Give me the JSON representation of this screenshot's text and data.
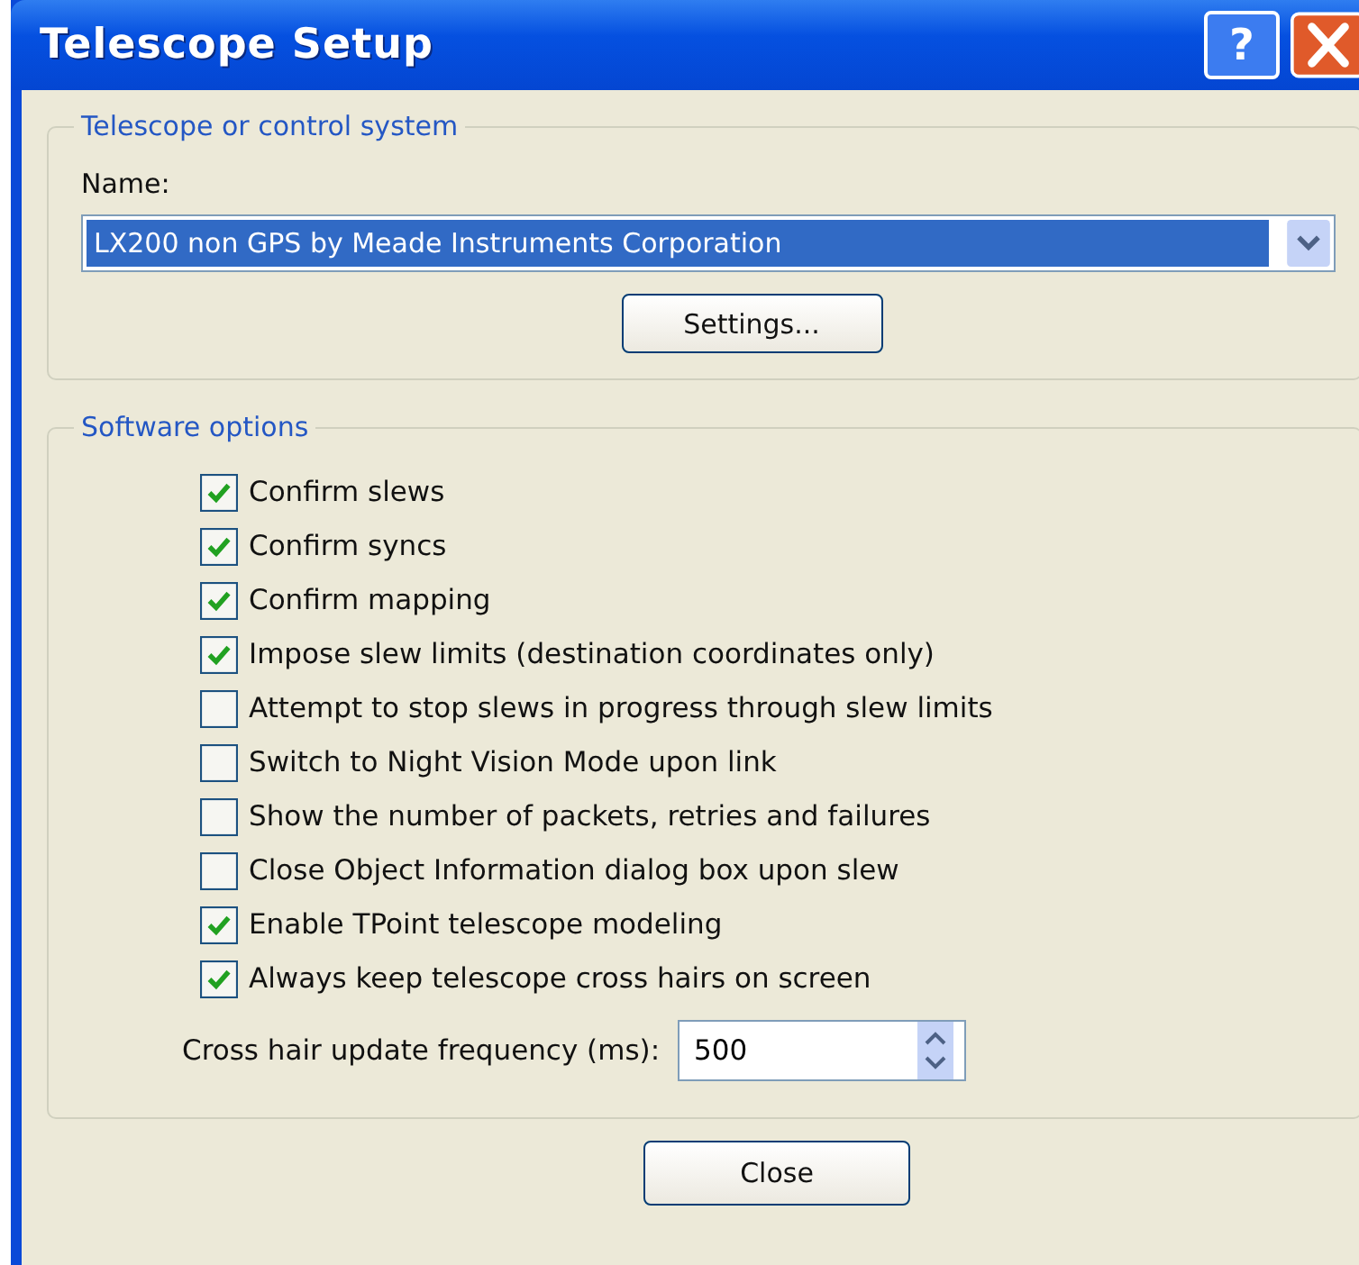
{
  "window": {
    "title": "Telescope Setup",
    "help_label": "?"
  },
  "telescope_group": {
    "title": "Telescope or control system",
    "name_label": "Name:",
    "selected_telescope": "LX200 non GPS by Meade Instruments Corporation",
    "settings_button": "Settings..."
  },
  "software_group": {
    "title": "Software options",
    "options": [
      {
        "label": "Confirm slews",
        "checked": true
      },
      {
        "label": "Confirm syncs",
        "checked": true
      },
      {
        "label": "Confirm mapping",
        "checked": true
      },
      {
        "label": "Impose slew limits (destination coordinates only)",
        "checked": true
      },
      {
        "label": "Attempt to stop slews in progress through slew limits",
        "checked": false
      },
      {
        "label": "Switch to Night Vision Mode upon link",
        "checked": false
      },
      {
        "label": "Show the number of packets, retries and failures",
        "checked": false
      },
      {
        "label": "Close Object Information dialog box upon slew",
        "checked": false
      },
      {
        "label": "Enable TPoint telescope modeling",
        "checked": true
      },
      {
        "label": "Always keep telescope cross hairs on screen",
        "checked": true
      }
    ],
    "frequency_label": "Cross hair update frequency (ms):",
    "frequency_value": "500"
  },
  "close_button": "Close"
}
